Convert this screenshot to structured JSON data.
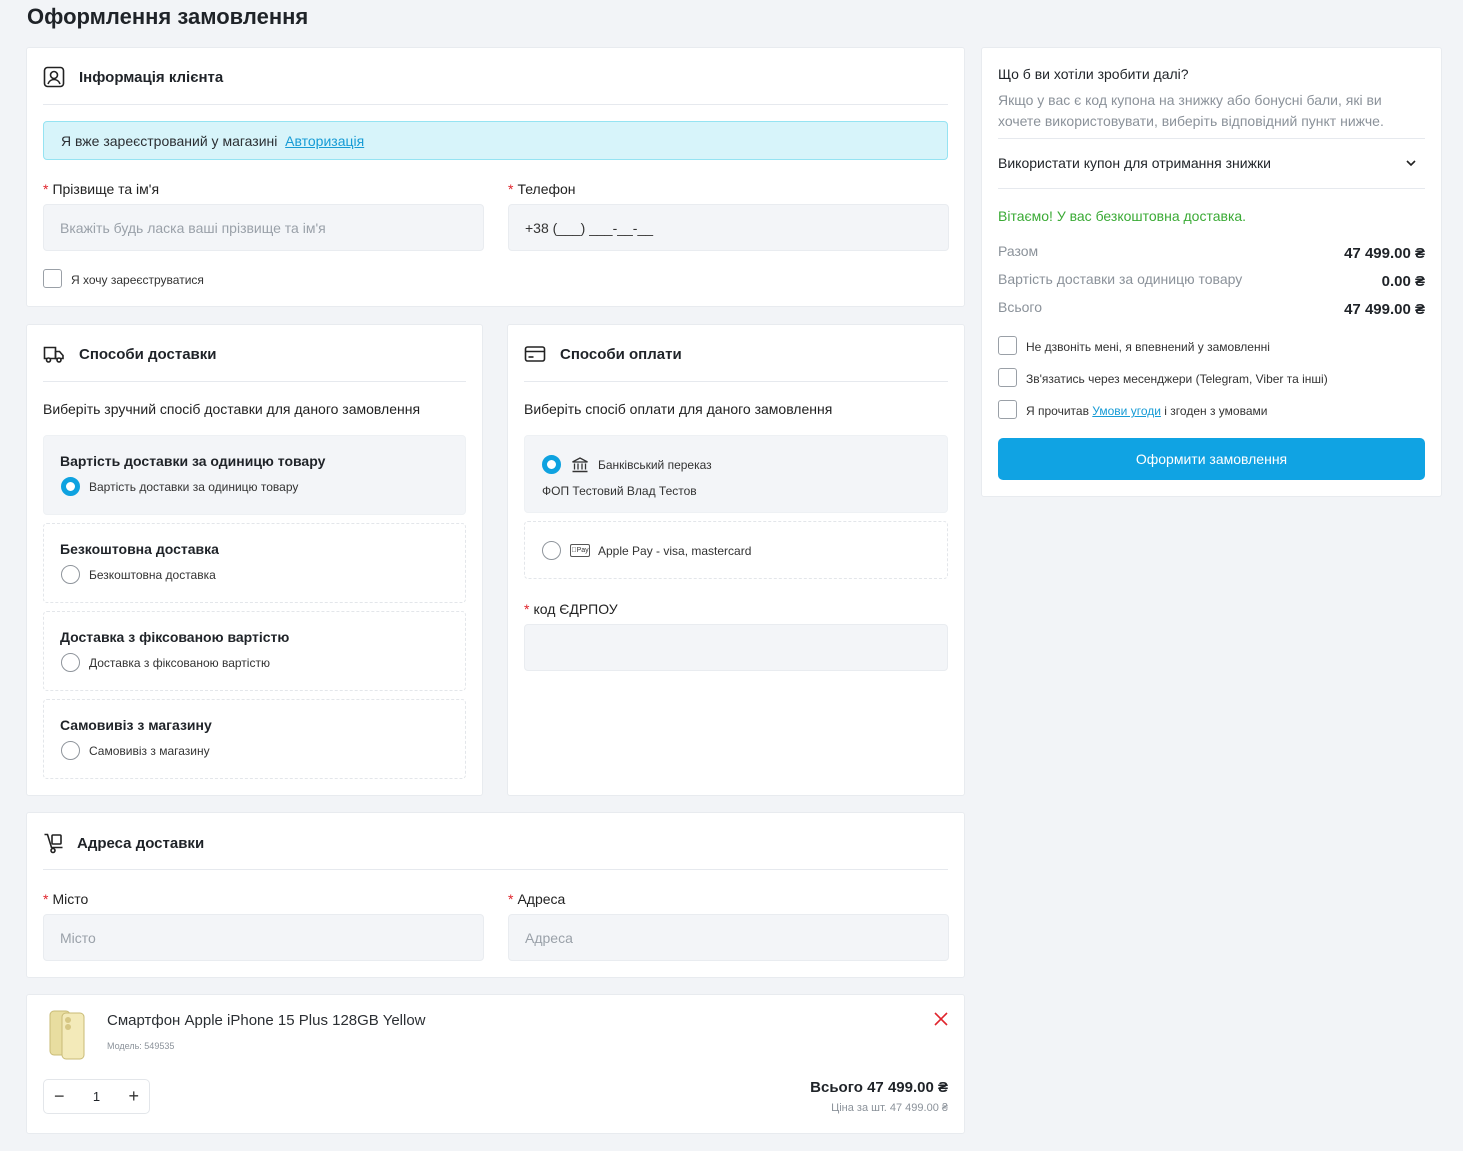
{
  "page_title": "Оформлення замовлення",
  "customer": {
    "title": "Інформація клієнта",
    "registered_text": "Я вже зареєстрований у магазині",
    "login_link": "Авторизація",
    "name_label": "Прізвище та ім'я",
    "name_placeholder": "Вкажіть будь ласка ваші прізвище та ім'я",
    "phone_label": "Телефон",
    "phone_value": "+38 (___) ___-__-__",
    "register_label": "Я хочу зареєструватися"
  },
  "delivery": {
    "title": "Способи доставки",
    "subtitle": "Виберіть зручний спосіб доставки для даного замовлення",
    "options": [
      {
        "title": "Вартість доставки за одиницю товару",
        "radio_label": "Вартість доставки за одиницю товару",
        "selected": true
      },
      {
        "title": "Безкоштовна доставка",
        "radio_label": "Безкоштовна доставка",
        "selected": false
      },
      {
        "title": "Доставка з фіксованою вартістю",
        "radio_label": "Доставка з фіксованою вартістю",
        "selected": false
      },
      {
        "title": "Самовивіз з магазину",
        "radio_label": "Самовивіз з магазину",
        "selected": false
      }
    ]
  },
  "payment": {
    "title": "Способи оплати",
    "subtitle": "Виберіть спосіб оплати для даного замовлення",
    "options": [
      {
        "label": "Банківський переказ",
        "sub": "ФОП Тестовий Влад Тестов",
        "icon": "bank-icon",
        "selected": true
      },
      {
        "label": "Apple Pay - visa, mastercard",
        "icon": "apple-pay-icon",
        "icon_text": "Pay",
        "selected": false
      }
    ],
    "edrpou_label": "код ЄДРПОУ"
  },
  "address": {
    "title": "Адреса доставки",
    "city_label": "Місто",
    "city_placeholder": "Місто",
    "addr_label": "Адреса",
    "addr_placeholder": "Адреса"
  },
  "product": {
    "name": "Смартфон Apple iPhone 15 Plus 128GB Yellow",
    "model": "Модель: 549535",
    "quantity": "1",
    "total": "Всього 47 499.00 ₴",
    "unit_price": "Ціна за шт. 47 499.00 ₴"
  },
  "sidebar": {
    "question": "Що б ви хотіли зробити далі?",
    "hint": "Якщо у вас є код купона на знижку або бонусні бали, які ви хочете використовувати, виберіть відповідний пункт нижче.",
    "coupon": "Використати купон для отримання знижки",
    "free_delivery": "Вітаємо! У вас безкоштовна доставка.",
    "totals": [
      {
        "label": "Разом",
        "value": "47 499.00 ₴"
      },
      {
        "label": "Вартість доставки за одиницю товару",
        "value": "0.00 ₴"
      },
      {
        "label": "Всього",
        "value": "47 499.00 ₴"
      }
    ],
    "opt_no_call": "Не дзвоніть мені, я впевнений у замовленні",
    "opt_messenger": "Зв'язатись через месенджери (Telegram, Viber та інші)",
    "terms_pre": "Я прочитав",
    "terms_link": "Умови угоди",
    "terms_post": "і згоден з умовами",
    "submit": "Оформити замовлення"
  },
  "colors": {
    "accent": "#10a3e3",
    "success": "#3aaa35",
    "error": "#e0242c",
    "info_bg": "#d7f4fa"
  }
}
